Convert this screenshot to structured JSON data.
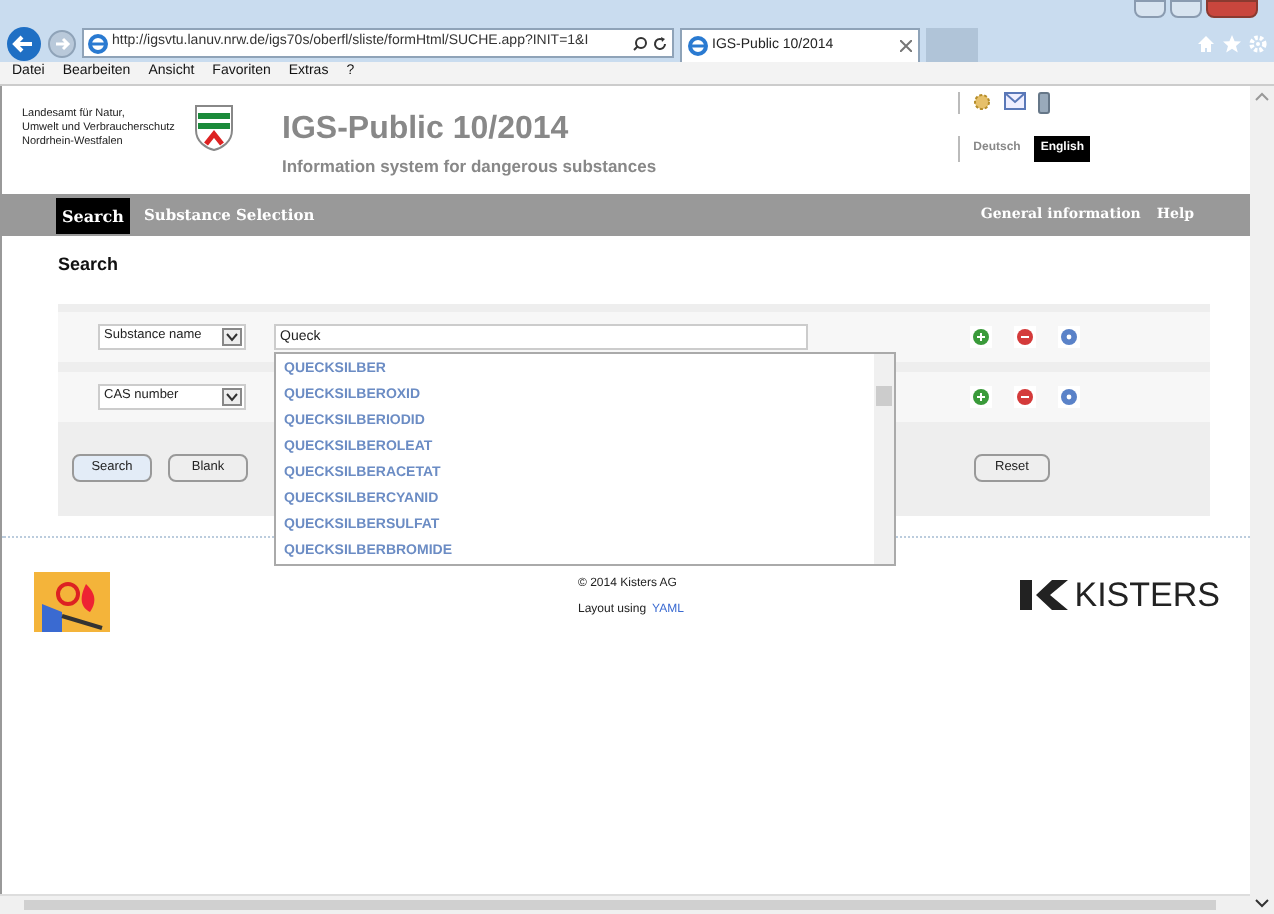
{
  "browser": {
    "url": "http://igsvtu.lanuv.nrw.de/igs70s/oberfl/sliste/formHtml/SUCHE.app?INIT=1&I",
    "tab_title": "IGS-Public 10/2014",
    "menu": [
      "Datei",
      "Bearbeiten",
      "Ansicht",
      "Favoriten",
      "Extras",
      "?"
    ]
  },
  "header": {
    "agency_lines": [
      "Landesamt für Natur,",
      "Umwelt und Verbraucherschutz",
      "Nordrhein-Westfalen"
    ],
    "title": "IGS-Public 10/2014",
    "subtitle": "Information system for dangerous substances",
    "languages": [
      {
        "label": "Deutsch",
        "selected": false
      },
      {
        "label": "English",
        "selected": true
      }
    ]
  },
  "nav": {
    "items": [
      {
        "label": "Search",
        "selected": true
      },
      {
        "label": "Substance Selection",
        "selected": false
      }
    ],
    "right_items": [
      "General information",
      "Help"
    ]
  },
  "search": {
    "heading": "Search",
    "rows": [
      {
        "criterion": "Substance name",
        "value": "Queck"
      },
      {
        "criterion": "CAS number",
        "value": ""
      }
    ],
    "suggestions": [
      "QUECKSILBER",
      "QUECKSILBEROXID",
      "QUECKSILBERIODID",
      "QUECKSILBEROLEAT",
      "QUECKSILBERACETAT",
      "QUECKSILBERCYANID",
      "QUECKSILBERSULFAT",
      "QUECKSILBERBROMIDE"
    ],
    "buttons": [
      "Search",
      "Blank"
    ],
    "reset": "Reset"
  },
  "footer": {
    "copyright": "© 2014 Kisters AG",
    "layout_text": "Layout using",
    "layout_link": "YAML",
    "brand": "KISTERS"
  }
}
